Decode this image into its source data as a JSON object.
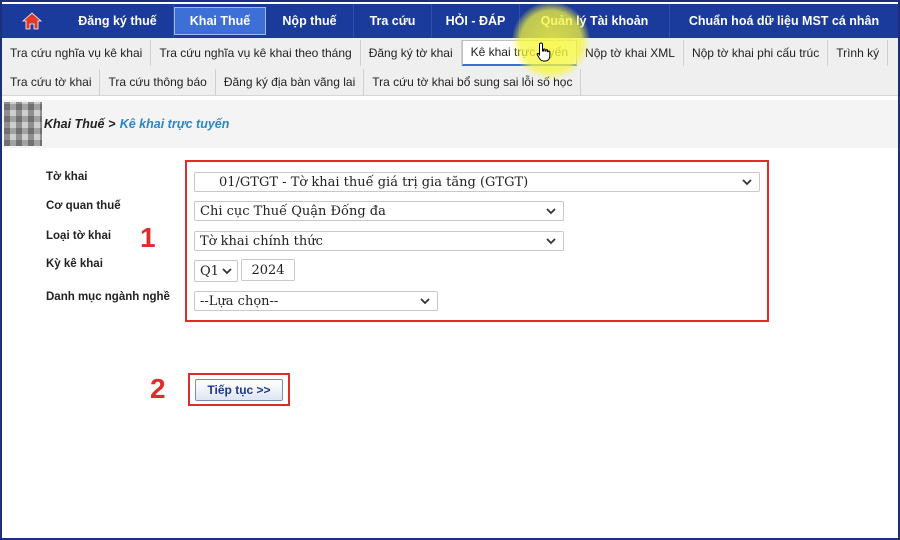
{
  "topnav": {
    "items": [
      {
        "label": "Đăng ký thuế"
      },
      {
        "label": "Khai Thuế"
      },
      {
        "label": "Nộp thuế"
      },
      {
        "label": "Tra cứu"
      },
      {
        "label": "HỎI - ĐÁP"
      },
      {
        "label": "Quản lý Tài khoản"
      },
      {
        "label": "Chuẩn hoá dữ liệu MST cá nhân"
      }
    ],
    "active_index": 1,
    "home_icon": "home-icon"
  },
  "submenu": {
    "row1": [
      {
        "label": "Tra cứu nghĩa vụ kê khai"
      },
      {
        "label": "Tra cứu nghĩa vụ kê khai theo tháng"
      },
      {
        "label": "Đăng ký tờ khai"
      },
      {
        "label": "Kê khai trực tuyến"
      },
      {
        "label": "Nộp tờ khai XML"
      },
      {
        "label": "Nộp tờ khai phi cấu trúc"
      },
      {
        "label": "Trình ký"
      }
    ],
    "row2": [
      {
        "label": "Tra cứu tờ khai"
      },
      {
        "label": "Tra cứu thông báo"
      },
      {
        "label": "Đăng ký địa bàn vãng lai"
      },
      {
        "label": "Tra cứu tờ khai bổ sung sai lỗi số học"
      }
    ]
  },
  "breadcrumb": {
    "parent": "Khai Thuế",
    "separator": ">",
    "current": "Kê khai trực tuyến"
  },
  "form": {
    "to_khai": {
      "label": "Tờ khai",
      "value": "01/GTGT - Tờ khai thuế giá trị gia tăng (GTGT)"
    },
    "co_quan_thue": {
      "label": "Cơ quan thuế",
      "value": "Chi cục Thuế Quận Đống đa"
    },
    "loai_to_khai": {
      "label": "Loại tờ khai",
      "value": "Tờ khai chính thức"
    },
    "ky_ke_khai": {
      "label": "Kỳ kê khai",
      "quarter": "Q1",
      "year": "2024"
    },
    "danh_muc": {
      "label": "Danh mục ngành nghề",
      "value": "--Lựa chọn--"
    }
  },
  "continue_button": "Tiếp tục >>",
  "annotations": {
    "step1": "1",
    "step2": "2"
  },
  "colors": {
    "nav_bg": "#1a3a9c",
    "nav_active": "#3d6fd6",
    "highlight": "#e02b2b",
    "crumb_link": "#2a86c9"
  }
}
